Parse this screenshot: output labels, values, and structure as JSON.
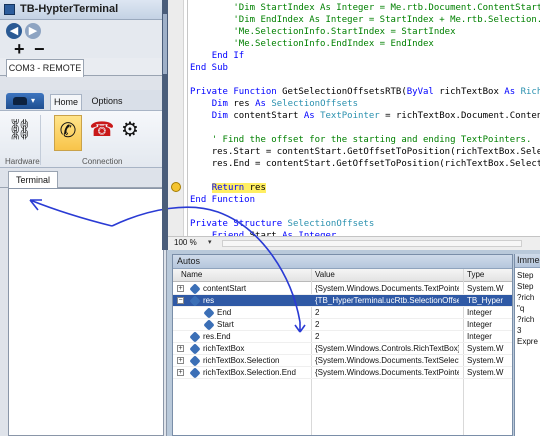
{
  "terminal_window": {
    "title": "TB-HypterTerminal",
    "qat": {
      "back_glyph": "◀",
      "fwd_glyph": "▶",
      "plus_glyph": "+",
      "minus_glyph": "−"
    },
    "doc_tab": "COM3 - REMOTE",
    "ribbon_tabs": [
      "Home",
      "Options"
    ],
    "ribbon_app_dropdown": "▾",
    "groups": {
      "hardware": "Hardware",
      "connection": "Connection"
    },
    "buttons": {
      "hardware_glyph": "⛓",
      "connect_glyph": "✆",
      "hangup_glyph": "☎",
      "settings_glyph": "⚙"
    },
    "terminal_tab": "Terminal"
  },
  "editor": {
    "lines": [
      {
        "indent": "        ",
        "parts": [
          {
            "c": "cm",
            "t": "'Dim StartIndex As Integer = Me.rtb.Document.ContentStart.GetOffsetToPosition"
          }
        ]
      },
      {
        "indent": "        ",
        "parts": [
          {
            "c": "cm",
            "t": "'Dim EndIndex As Integer = StartIndex + Me.rtb.Selection.Text.Length"
          }
        ]
      },
      {
        "indent": "        ",
        "parts": [
          {
            "c": "cm",
            "t": "'Me.SelectionInfo.StartIndex = StartIndex"
          }
        ]
      },
      {
        "indent": "        ",
        "parts": [
          {
            "c": "cm",
            "t": "'Me.SelectionInfo.EndIndex = EndIndex"
          }
        ]
      },
      {
        "indent": "    ",
        "parts": [
          {
            "c": "kw",
            "t": "End If"
          }
        ]
      },
      {
        "indent": "",
        "parts": [
          {
            "c": "kw",
            "t": "End Sub"
          }
        ]
      },
      {
        "indent": "",
        "parts": []
      },
      {
        "indent": "",
        "parts": [
          {
            "c": "kw",
            "t": "Private Function "
          },
          {
            "c": "",
            "t": "GetSelectionOffsetsRTB("
          },
          {
            "c": "kw",
            "t": "ByVal "
          },
          {
            "c": "",
            "t": "richTextBox "
          },
          {
            "c": "kw",
            "t": "As "
          },
          {
            "c": "ty",
            "t": "RichTextBox"
          },
          {
            "c": "",
            "t": ")"
          }
        ]
      },
      {
        "indent": "    ",
        "parts": [
          {
            "c": "kw",
            "t": "Dim "
          },
          {
            "c": "",
            "t": "res "
          },
          {
            "c": "kw",
            "t": "As "
          },
          {
            "c": "ty",
            "t": "SelectionOffsets"
          }
        ]
      },
      {
        "indent": "    ",
        "parts": [
          {
            "c": "kw",
            "t": "Dim "
          },
          {
            "c": "",
            "t": "contentStart "
          },
          {
            "c": "kw",
            "t": "As "
          },
          {
            "c": "ty",
            "t": "TextPointer"
          },
          {
            "c": "",
            "t": " = richTextBox.Document.ContentStart"
          }
        ]
      },
      {
        "indent": "",
        "parts": []
      },
      {
        "indent": "    ",
        "parts": [
          {
            "c": "cm",
            "t": "' Find the offset for the starting and ending TextPointers."
          }
        ]
      },
      {
        "indent": "    ",
        "parts": [
          {
            "c": "",
            "t": "res.Start = contentStart.GetOffsetToPosition(richTextBox.Selection.Start)"
          }
        ]
      },
      {
        "indent": "    ",
        "parts": [
          {
            "c": "",
            "t": "res.End = contentStart.GetOffsetToPosition(richTextBox.Selection.End)"
          }
        ]
      },
      {
        "indent": "",
        "parts": []
      },
      {
        "indent": "    ",
        "parts": [
          {
            "c": "kw ret-hl",
            "t": "Return "
          },
          {
            "c": "ret-hl",
            "t": "res"
          }
        ]
      },
      {
        "indent": "",
        "parts": [
          {
            "c": "kw",
            "t": "End Function"
          }
        ]
      },
      {
        "indent": "",
        "parts": []
      },
      {
        "indent": "",
        "parts": [
          {
            "c": "kw",
            "t": "Private Structure "
          },
          {
            "c": "ty",
            "t": "SelectionOffsets"
          }
        ]
      },
      {
        "indent": "    ",
        "parts": [
          {
            "c": "kw",
            "t": "Friend "
          },
          {
            "c": "",
            "t": "Start "
          },
          {
            "c": "kw",
            "t": "As "
          },
          {
            "c": "kw",
            "t": "Integer"
          }
        ]
      }
    ],
    "zoom": "100 %",
    "zoom_arrow": "▾"
  },
  "autos": {
    "title": "Autos",
    "columns": [
      "Name",
      "Value",
      "Type"
    ],
    "rows": [
      {
        "exp": "+",
        "name": "contentStart",
        "value": "{System.Windows.Documents.TextPointer}",
        "type": "System.W",
        "selected": false,
        "child": false
      },
      {
        "exp": "−",
        "name": "res",
        "value": "{TB_HyperTerminal.ucRtb.SelectionOffsets}",
        "type": "TB_Hyper",
        "selected": true,
        "child": false
      },
      {
        "exp": "",
        "name": "End",
        "value": "2",
        "type": "Integer",
        "selected": false,
        "child": true
      },
      {
        "exp": "",
        "name": "Start",
        "value": "2",
        "type": "Integer",
        "selected": false,
        "child": true
      },
      {
        "exp": "",
        "name": "res.End",
        "value": "2",
        "type": "Integer",
        "selected": false,
        "child": false
      },
      {
        "exp": "+",
        "name": "richTextBox",
        "value": "{System.Windows.Controls.RichTextBox}",
        "type": "System.W",
        "selected": false,
        "child": false
      },
      {
        "exp": "+",
        "name": "richTextBox.Selection",
        "value": "{System.Windows.Documents.TextSelection}",
        "type": "System.W",
        "selected": false,
        "child": false
      },
      {
        "exp": "+",
        "name": "richTextBox.Selection.End",
        "value": "{System.Windows.Documents.TextPointer}",
        "type": "System.W",
        "selected": false,
        "child": false
      }
    ]
  },
  "immediate": {
    "title": "Immediate",
    "lines": [
      "Step",
      "Step",
      "?rich",
      "\"q",
      "?rich",
      "3",
      "Expre"
    ]
  },
  "colors": {
    "accent": "#2f59a5",
    "keyword": "#0000ff",
    "type": "#2b91af",
    "comment": "#008000",
    "annotation": "#2a3bd4"
  }
}
